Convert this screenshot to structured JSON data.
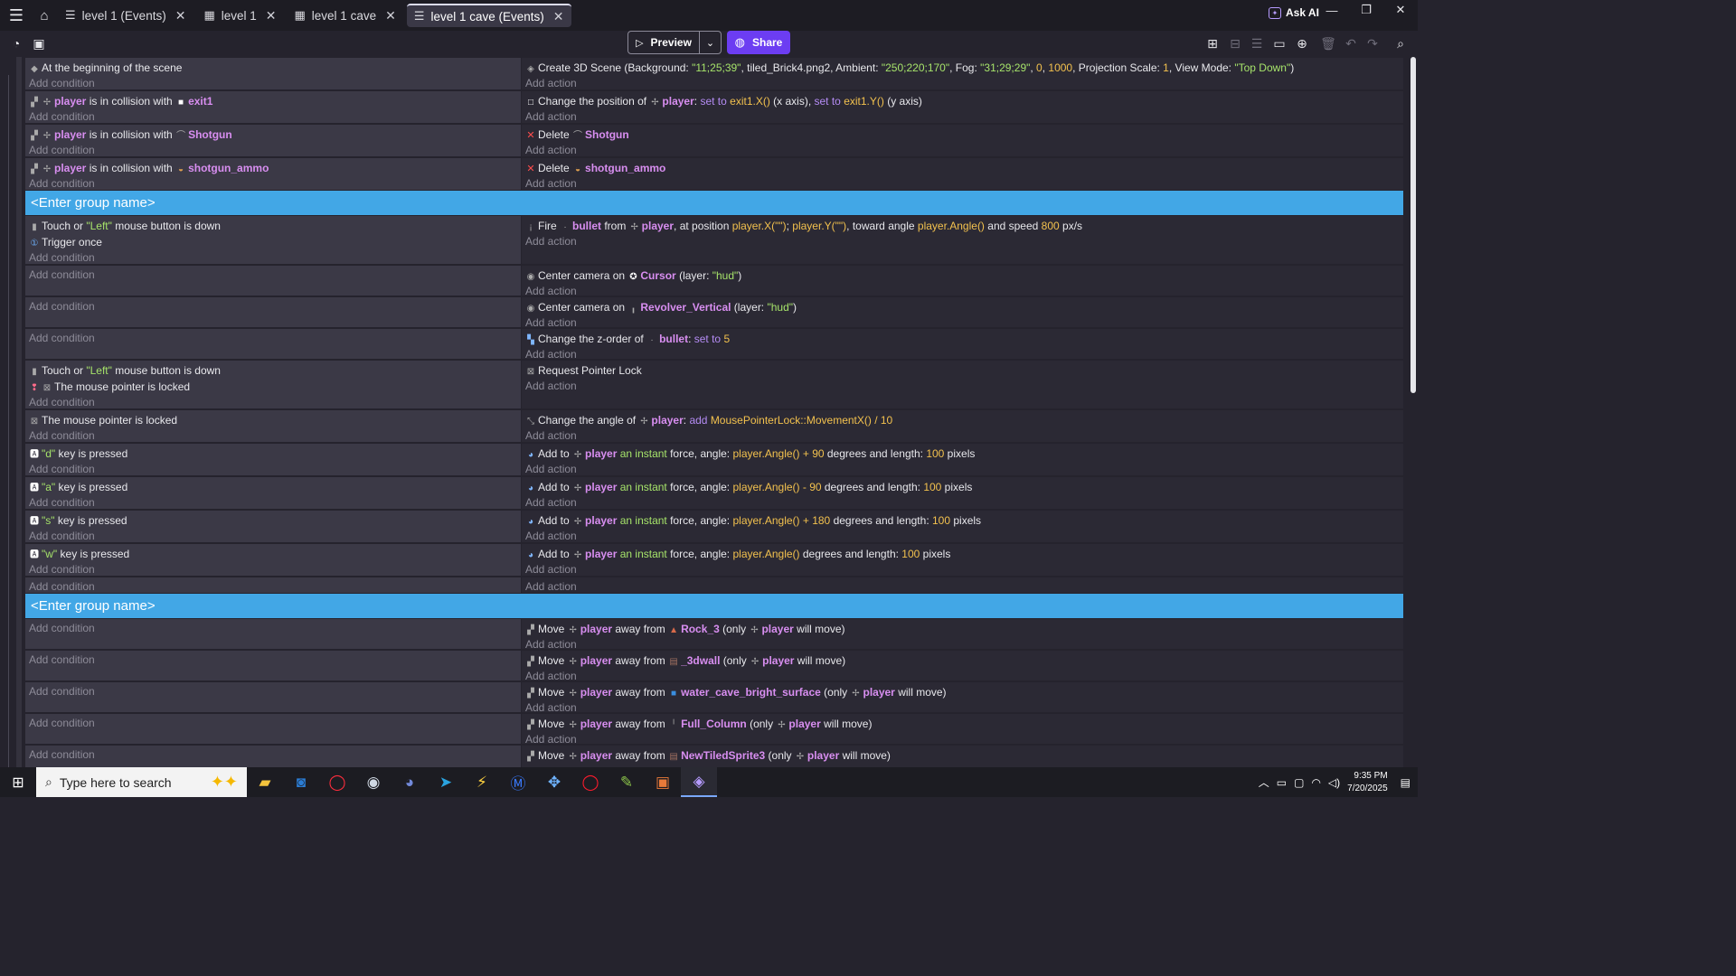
{
  "titlebar": {
    "tabs": [
      {
        "label": "level 1 (Events)",
        "icon": "events-icon",
        "active": false
      },
      {
        "label": "level 1",
        "icon": "scene-icon",
        "active": false
      },
      {
        "label": "level 1 cave",
        "icon": "scene-icon",
        "active": false
      },
      {
        "label": "level 1 cave (Events)",
        "icon": "events-icon",
        "active": true
      }
    ],
    "ask_ai": "Ask AI"
  },
  "toolbar": {
    "preview_label": "Preview",
    "share_label": "Share"
  },
  "groups": [
    "<Enter group name>",
    "<Enter group name>"
  ],
  "add_condition": "Add condition",
  "add_action": "Add action",
  "events": {
    "e1": {
      "cond": "At the beginning of the scene",
      "act_a": "Create 3D Scene (Background: ",
      "bg": "\"11;25;39\"",
      "act_b": ", tiled_Brick4.png2, Ambient: ",
      "amb": "\"250;220;170\"",
      "act_c": ", Fog: ",
      "fog": "\"31;29;29\"",
      "act_d": ", ",
      "n0": "0",
      "act_e": ", ",
      "n1000": "1000",
      "act_f": ", Projection Scale: ",
      "ps": "1",
      "act_g": ", View Mode: ",
      "vm": "\"Top Down\"",
      "act_h": ")"
    },
    "e2": {
      "obj": "player",
      "mid": " is in collision with ",
      "target": "exit1",
      "act_a": "Change the position of ",
      "act_obj": "player",
      "act_b": ": ",
      "set1": "set to ",
      "x": "exit1.X()",
      "act_c": " (x axis), ",
      "set2": "set to ",
      "y": "exit1.Y()",
      "act_d": " (y axis)"
    },
    "e3": {
      "obj": "player",
      "mid": " is in collision with ",
      "target": "Shotgun",
      "act_a": "Delete ",
      "act_obj": "Shotgun"
    },
    "e4": {
      "obj": "player",
      "mid": " is in collision with ",
      "target": "shotgun_ammo",
      "act_a": "Delete ",
      "act_obj": "shotgun_ammo"
    },
    "e5": {
      "c1a": "Touch or ",
      "c1s": "\"Left\"",
      "c1b": " mouse button is down",
      "c2": "Trigger once",
      "a1": "Fire ",
      "a_bullet": "bullet",
      "a2": " from ",
      "a_player": "player",
      "a3": ", at position ",
      "a_px": "player.X(\"\")",
      "a4": "; ",
      "a_py": "player.Y(\"\")",
      "a5": ", toward angle ",
      "a_ang": "player.Angle()",
      "a6": " and speed ",
      "a_spd": "800",
      "a7": " px/s"
    },
    "e6": {
      "a1": "Center camera on ",
      "a_obj": "Cursor",
      "a2": " (layer: ",
      "a_layer": "\"hud\"",
      "a3": ")"
    },
    "e7": {
      "a1": "Center camera on ",
      "a_obj": "Revolver_Vertical",
      "a2": " (layer: ",
      "a_layer": "\"hud\"",
      "a3": ")"
    },
    "e8": {
      "a1": "Change the z-order of ",
      "a_obj": "bullet",
      "a2": ": ",
      "a_set": "set to ",
      "a_num": "5"
    },
    "e9": {
      "c1a": "Touch or ",
      "c1s": "\"Left\"",
      "c1b": " mouse button is down",
      "c2": "The mouse pointer is locked",
      "a1": "Request Pointer Lock"
    },
    "e10": {
      "c1": "The mouse pointer is locked",
      "a1": "Change the angle of ",
      "a_obj": "player",
      "a2": ": ",
      "a_add": "add ",
      "a_expr": "MousePointerLock::MovementX() / 10"
    },
    "e11": {
      "key": "\"d\"",
      "kp": " key is pressed",
      "a1": "Add to ",
      "a_obj": "player",
      "a_inst": " an instant",
      "a2": " force, angle: ",
      "a_ang": "player.Angle() + 90",
      "a3": " degrees and length: ",
      "a_len": "100",
      "a4": " pixels"
    },
    "e12": {
      "key": "\"a\"",
      "kp": " key is pressed",
      "a1": "Add to ",
      "a_obj": "player",
      "a_inst": " an instant",
      "a2": " force, angle: ",
      "a_ang": "player.Angle() - 90",
      "a3": " degrees and length: ",
      "a_len": "100",
      "a4": " pixels"
    },
    "e13": {
      "key": "\"s\"",
      "kp": " key is pressed",
      "a1": "Add to ",
      "a_obj": "player",
      "a_inst": " an instant",
      "a2": " force, angle: ",
      "a_ang": "player.Angle() + 180",
      "a3": " degrees and length: ",
      "a_len": "100",
      "a4": " pixels"
    },
    "e14": {
      "key": "\"w\"",
      "kp": " key is pressed",
      "a1": "Add to ",
      "a_obj": "player",
      "a_inst": " an instant",
      "a2": " force, angle: ",
      "a_ang": "player.Angle()",
      "a3": " degrees and length: ",
      "a_len": "100",
      "a4": " pixels"
    },
    "m1": {
      "a1": "Move ",
      "a_p": "player",
      "a2": " away from ",
      "a_t": "Rock_3",
      "a3": " (only ",
      "a_p2": "player",
      "a4": " will move)"
    },
    "m2": {
      "a1": "Move ",
      "a_p": "player",
      "a2": " away from ",
      "a_t": "_3dwall",
      "a3": " (only ",
      "a_p2": "player",
      "a4": " will move)"
    },
    "m3": {
      "a1": "Move ",
      "a_p": "player",
      "a2": " away from ",
      "a_t": "water_cave_bright_surface",
      "a3": " (only ",
      "a_p2": "player",
      "a4": " will move)"
    },
    "m4": {
      "a1": "Move ",
      "a_p": "player",
      "a2": " away from ",
      "a_t": "Full_Column",
      "a3": " (only ",
      "a_p2": "player",
      "a4": " will move)"
    },
    "m5": {
      "a1": "Move ",
      "a_p": "player",
      "a2": " away from ",
      "a_t": "NewTiledSprite3",
      "a3": " (only ",
      "a_p2": "player",
      "a4": " will move)"
    }
  },
  "taskbar": {
    "search_placeholder": "Type here to search",
    "time": "9:35 PM",
    "date": "7/20/2025"
  },
  "colors": {
    "group_header": "#42a7e6",
    "share_button": "#6c3df2",
    "object_name": "#d88ef0",
    "string_value": "#a6e36a",
    "number_value": "#f2c14e"
  }
}
